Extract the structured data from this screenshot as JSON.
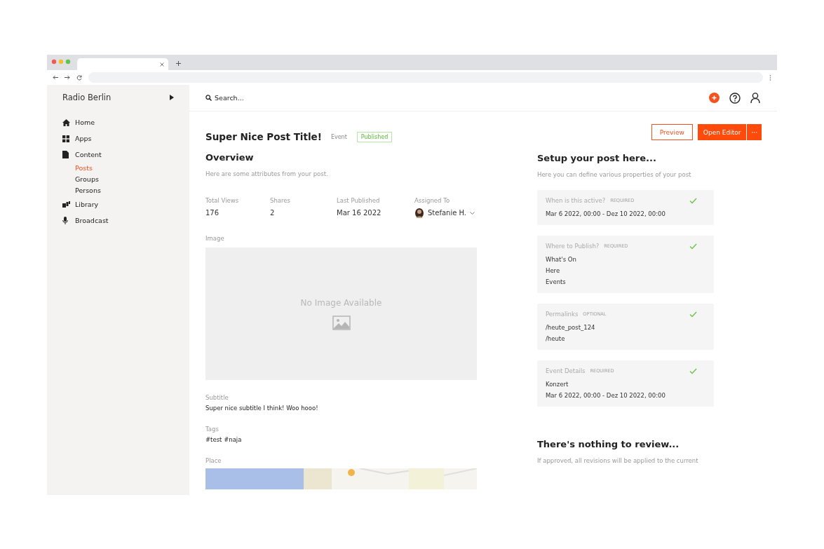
{
  "sidebar": {
    "title": "Radio Berlin",
    "items": [
      {
        "label": "Home",
        "kind": "home",
        "selected": false
      },
      {
        "label": "Apps",
        "kind": "apps",
        "selected": false
      },
      {
        "label": "Content",
        "kind": "doc",
        "selected": false,
        "children": [
          {
            "label": "Posts",
            "selected": true
          },
          {
            "label": "Groups",
            "selected": false
          },
          {
            "label": "Persons",
            "selected": false
          }
        ]
      },
      {
        "label": "Library",
        "kind": "library",
        "selected": false
      },
      {
        "label": "Broadcast",
        "kind": "mic",
        "selected": false
      }
    ]
  },
  "search": {
    "placeholder": "Search..."
  },
  "post": {
    "title": "Super Nice Post Title!",
    "type": "Event",
    "status": "Published"
  },
  "buttons": {
    "preview": "Preview",
    "open_editor": "Open Editor",
    "more": "···"
  },
  "overview": {
    "heading": "Overview",
    "description": "Here are some attributes from your post.",
    "stats": [
      {
        "label": "Total Views",
        "value": "176",
        "kind": "text"
      },
      {
        "label": "Shares",
        "value": "2",
        "kind": "text"
      },
      {
        "label": "Last Published",
        "value": "Mar 16 2022",
        "kind": "text"
      },
      {
        "label": "Assigned To",
        "value": "Stefanie H.",
        "kind": "person"
      }
    ],
    "image": {
      "label": "Image",
      "empty_text": "No Image Available"
    },
    "fields": [
      {
        "label": "Subtitle",
        "value": "Super nice subtitle I think! Woo hooo!"
      },
      {
        "label": "Tags",
        "value": "#test #naja"
      }
    ],
    "place": {
      "label": "Place"
    }
  },
  "setup": {
    "heading": "Setup your post here...",
    "description": "Here you can define various properties of your post",
    "cards": [
      {
        "title": "When is this active?",
        "badge": "REQUIRED",
        "checked": true,
        "lines": [
          "Mar 6 2022, 00:00 - Dez 10 2022, 00:00"
        ]
      },
      {
        "title": "Where to Publish?",
        "badge": "REQUIRED",
        "checked": true,
        "lines": [
          "What's On",
          "Here",
          "Events"
        ]
      },
      {
        "title": "Permalinks",
        "badge": "OPTIONAL",
        "checked": true,
        "lines": [
          "/heute_post_124",
          "/heute"
        ]
      },
      {
        "title": "Event Details",
        "badge": "REQUIRED",
        "checked": true,
        "lines": [
          "Konzert",
          "Mar 6 2022, 00:00 - Dez 10 2022, 00:00"
        ]
      }
    ]
  },
  "review": {
    "heading": "There's nothing to review...",
    "description": "If approved, all revisions will be applied to the current"
  }
}
